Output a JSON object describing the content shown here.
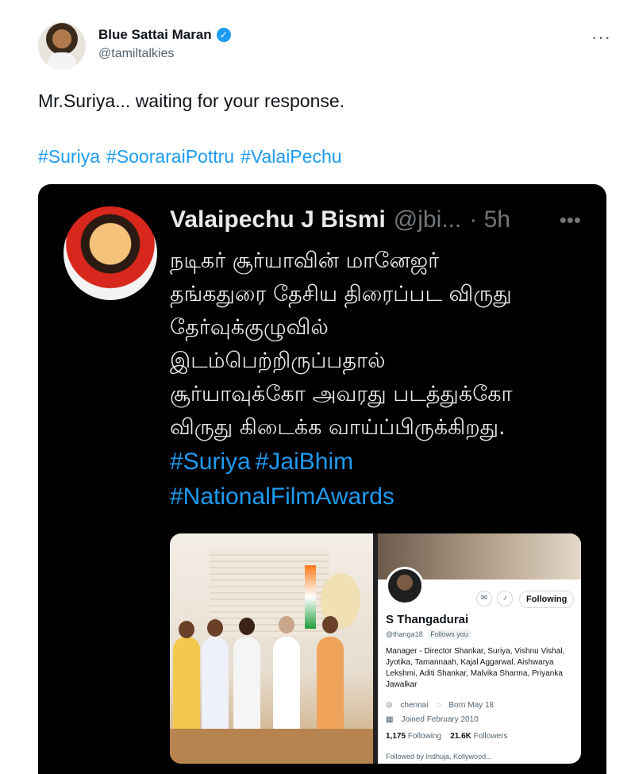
{
  "tweet": {
    "author_name": "Blue Sattai Maran",
    "author_handle": "@tamiltalkies",
    "text": "Mr.Suriya... waiting for your response.",
    "hashtags": [
      "#Suriya",
      "#SooraraiPottru",
      "#ValaiPechu"
    ],
    "more_icon": "more-horizontal-icon",
    "verified_icon": "verified-badge-icon"
  },
  "embedded": {
    "author_name": "Valaipechu J Bismi",
    "author_handle": "@jbi...",
    "time": "· 5h",
    "tamil_lines": [
      "நடிகர் சூர்யாவின் மானேஜர்",
      "தங்கதுரை தேசிய திரைப்பட விருது",
      "தேர்வுக்குழுவில்",
      "இடம்பெற்றிருப்பதால்",
      "சூர்யாவுக்கோ அவரது படத்துக்கோ",
      "விருது கிடைக்க வாய்ப்பிருக்கிறது."
    ],
    "hashtag_lines": [
      [
        "#Suriya",
        "#JaiBhim"
      ],
      [
        "#NationalFilmAwards"
      ]
    ],
    "profile": {
      "name": "S Thangadurai",
      "handle": "@thanga18",
      "follows_you": "Follows you",
      "follow_button": "Following",
      "bio": "Manager - Director Shankar, Suriya, Vishnu Vishal, Jyotika, Tamannaah, Kajal Aggarwal, Aishwarya Lekshmi, Aditi Shankar, Malvika Sharma, Priyanka Jawalkar",
      "location": "chennai",
      "born": "Born May 18",
      "joined": "Joined February 2010",
      "following_count": "1,175",
      "following_label": "Following",
      "followers_count": "21.6K",
      "followers_label": "Followers",
      "followed_by": "Followed by Indhuja, Kollywood..."
    }
  },
  "colors": {
    "link": "#1d9bf0",
    "secondary_text": "#536471",
    "embed_bg": "#000000"
  }
}
